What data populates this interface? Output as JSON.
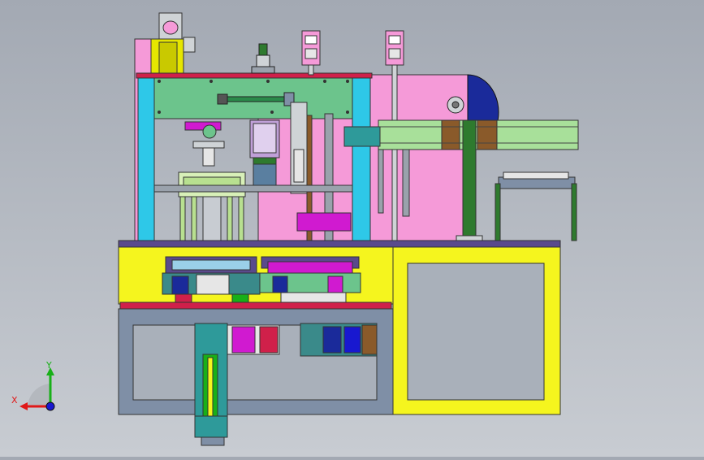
{
  "viewport": {
    "background_top": "#a3a9b3",
    "background_bottom": "#c8ccd2"
  },
  "triad": {
    "x_label": "X",
    "y_label": "Y",
    "x_color": "#e01818",
    "y_color": "#18b018",
    "z_color": "#1818d0"
  },
  "colors": {
    "cyan": "#2ec8e8",
    "green_plate": "#6cc48c",
    "pink": "#f59ad8",
    "yellow": "#f5f51e",
    "steel": "#7f8fa6",
    "purple": "#5a4a8c",
    "dark_green": "#2e7a2e",
    "magenta": "#d01ad0",
    "navy": "#1a2a9a",
    "crimson": "#d0204a",
    "conveyor_green": "#a8e09a",
    "brown": "#8a5a2a"
  }
}
